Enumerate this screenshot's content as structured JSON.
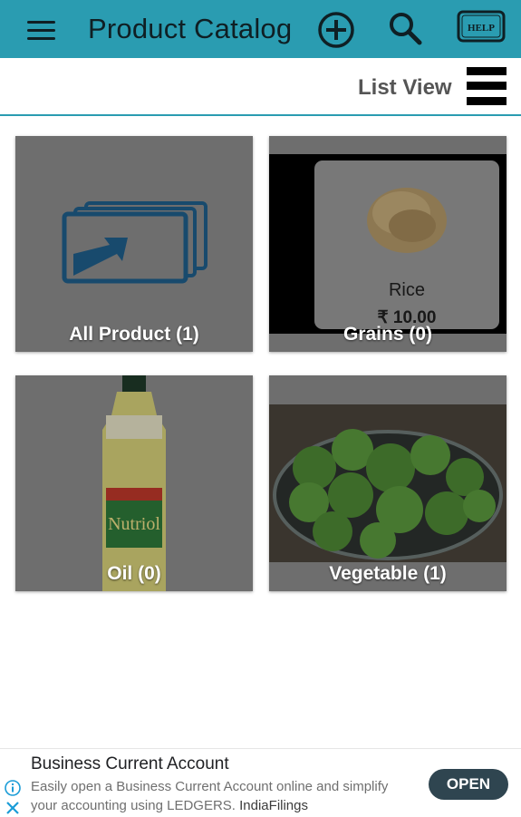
{
  "app": {
    "title": "Product Catalog",
    "icons": [
      "menu-icon",
      "add-circle-icon",
      "search-icon",
      "help-icon"
    ],
    "help_label": "HELP",
    "colors": {
      "appbar": "#2a9cb1",
      "tile_overlay": "#8e8e8e",
      "ad_button": "#2f4550"
    }
  },
  "view": {
    "label": "List View",
    "icon": "list-view-icon"
  },
  "categories": [
    {
      "label": "All Product (1)",
      "icon": "stacked-cards-arrow-icon"
    },
    {
      "label": "Grains (0)",
      "product_name": "Rice",
      "product_price": "₹ 10.00"
    },
    {
      "label": "Oil (0)",
      "bottle_brand": "Nutriol"
    },
    {
      "label": "Vegetable (1)"
    }
  ],
  "ad": {
    "title": "Business Current Account",
    "body": "Easily open a Business Current Account online and simplify your accounting using LEDGERS.",
    "advertiser": "IndiaFilings",
    "button_label": "OPEN",
    "icons": [
      "info-icon",
      "close-icon"
    ]
  }
}
